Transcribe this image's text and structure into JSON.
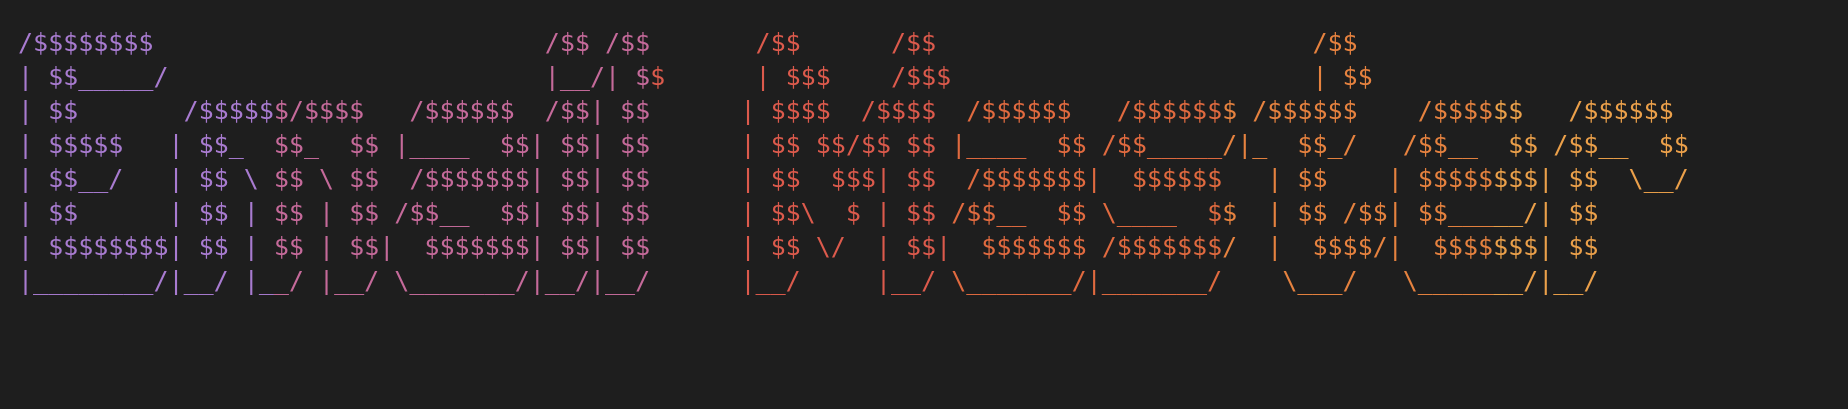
{
  "banner": {
    "palette": [
      "#a87bd0",
      "#c56a9a",
      "#dc5a4c",
      "#e06a3f",
      "#e6823f",
      "#eba04a"
    ],
    "lines": [
      "/$$$$$$$$                          /$$ /$$       /$$      /$$                         /$$",
      "| $$_____/                         |__/| $$      | $$$    /$$$                        | $$",
      "| $$       /$$$$$$/$$$$   /$$$$$$  /$$| $$      | $$$$  /$$$$  /$$$$$$   /$$$$$$$ /$$$$$$    /$$$$$$   /$$$$$$",
      "| $$$$$   | $$_  $$_  $$ |____  $$| $$| $$      | $$ $$/$$ $$ |____  $$ /$$_____/|_  $$_/   /$$__  $$ /$$__  $$",
      "| $$__/   | $$ \\ $$ \\ $$  /$$$$$$$| $$| $$      | $$  $$$| $$  /$$$$$$$|  $$$$$$   | $$    | $$$$$$$$| $$  \\__/",
      "| $$      | $$ | $$ | $$ /$$__  $$| $$| $$      | $$\\  $ | $$ /$$__  $$ \\____  $$  | $$ /$$| $$_____/| $$",
      "| $$$$$$$$| $$ | $$ | $$|  $$$$$$$| $$| $$      | $$ \\/  | $$|  $$$$$$$ /$$$$$$$/  |  $$$$/|  $$$$$$$| $$",
      "|________/|__/ |__/ |__/ \\_______/|__/|__/      |__/     |__/ \\_______/|_______/    \\___/   \\_______/|__/"
    ]
  }
}
